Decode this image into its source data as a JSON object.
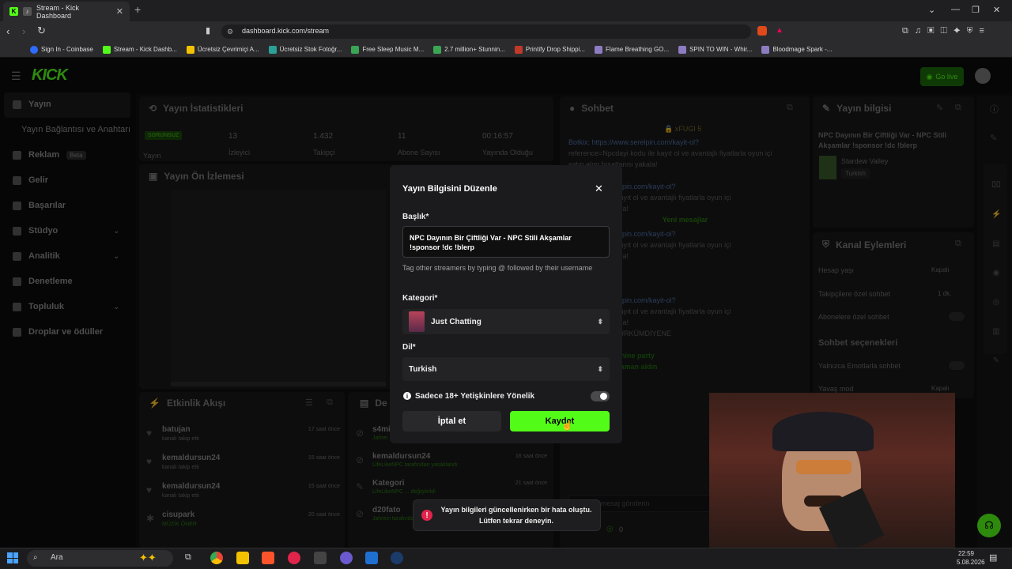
{
  "browser": {
    "tab_title": "Stream - Kick Dashboard",
    "url": "dashboard.kick.com/stream",
    "bookmarks": [
      "Sign In - Coinbase",
      "Stream - Kick Dashb...",
      "Ücretsiz Çevrimiçi A...",
      "Ücretsiz Stok Fotoğr...",
      "Free Sleep Music M...",
      "2.7 million+ Stunnin...",
      "Printify Drop Shippi...",
      "Flame Breathing GO...",
      "SPIN TO WIN - Whir...",
      "Bloodmage Spark -..."
    ]
  },
  "header": {
    "go_live": "Go live"
  },
  "sidebar": {
    "items": [
      {
        "label": "Yayın"
      },
      {
        "label": "Yayın Bağlantısı ve Anahtarı"
      },
      {
        "label": "Reklam",
        "badge": "Beta"
      },
      {
        "label": "Gelir"
      },
      {
        "label": "Başarılar"
      },
      {
        "label": "Stüdyo"
      },
      {
        "label": "Analitik"
      },
      {
        "label": "Denetleme"
      },
      {
        "label": "Topluluk"
      },
      {
        "label": "Droplar ve ödüller"
      }
    ]
  },
  "stats": {
    "title": "Yayın İstatistikleri",
    "status": "SORUNSUZ",
    "status_label": "Yayın",
    "items": [
      {
        "value": "13",
        "label": "İzleyici"
      },
      {
        "value": "1.432",
        "label": "Takipçi"
      },
      {
        "value": "11",
        "label": "Abone Sayısı"
      },
      {
        "value": "00:16:57",
        "label": "Yayında Olduğu"
      }
    ]
  },
  "preview": {
    "title": "Yayın Ön İzlemesi"
  },
  "activity": {
    "title": "Etkinlik Akışı",
    "events": [
      {
        "user": "batujan",
        "desc": "kanalı takip etti",
        "time": "17 saat önce"
      },
      {
        "user": "kemaldursun24",
        "desc": "kanalı takip etti",
        "time": "15 saat önce"
      },
      {
        "user": "kemaldursun24",
        "desc": "kanalı takip etti",
        "time": "15 saat önce"
      },
      {
        "user": "cisupark",
        "desc": "MÜZİK ÖNER",
        "time": "20 saat önce"
      }
    ]
  },
  "activity2": {
    "title": "De",
    "events": [
      {
        "user": "s4mi",
        "desc": "Jahrei",
        "time": ""
      },
      {
        "user": "kemaldursun24",
        "desc": "LifeLikeNPC tarafından yasaklandı",
        "time": "16 saat önce"
      },
      {
        "user": "Kategori",
        "desc": "LifeLikeNPC ... değiştirildi",
        "time": "21 saat önce"
      },
      {
        "user": "d20fato",
        "desc": "Jahrein tarafından",
        "time": ""
      }
    ]
  },
  "chat": {
    "title": "Sohbet",
    "pinned_user": "xFUGI",
    "new_messages": "Yeni mesajlar",
    "send_placeholder": "mesaj gönderin",
    "count": "0",
    "lines": [
      "Botkix: https://www.serelpin.com/kayit-ol?",
      "reference=Npcdayi kodu ile kayıt ol ve avantajlı fiyatlarla oyun içi",
      "satın alım fırsatlarını yakala!",
      "piteopaen:",
      "https://www.serelpin.com/kayit-ol?",
      "...dayi kodu ile kayıt ol ve avantajlı fiyatlarla oyun içi",
      "...ırsatlarını yakala!",
      "https://www.serelpin.com/kayit-ol?",
      "...dayi kodu ile kayıt ol ve avantajlı fiyatlarla oyun içi",
      "...ırsatlarını yakala!",
      "piteopaen: hi hi",
      "piteopaen:",
      "piteopaen:",
      "https://www.serelpin.com/kayit-ol?",
      "...dayi kodu ile kayıt ol ve avantajlı fiyatlarla oyun içi",
      "...ırsatlarını yakala!",
      "...ONEMUTLUTÜRKÜMDİYENE",
      "...ERDESİN",
      "piteopaen: machine party",
      "piteopaen: ne zaman aldın",
      "Takipçilere Özel"
    ]
  },
  "stream_info": {
    "title": "Yayın bilgisi",
    "stream_title": "NPC Dayının Bir Çiftliği Var - NPC Stili Akşamlar !sponsor !dc !blerp",
    "game": "Stardew Valley",
    "language": "Turkish"
  },
  "channel_actions": {
    "title": "Kanal Eylemleri",
    "rows": [
      {
        "label": "Hesap yaşı",
        "value": "Kapalı"
      },
      {
        "label": "Takipçilere özel sohbet",
        "value": "1 dk."
      },
      {
        "label": "Abonelere özel sohbet",
        "value": ""
      }
    ],
    "chat_options_title": "Sohbet seçenekleri",
    "options": [
      {
        "label": "Yalnızca Emotlarla sohbet",
        "value": ""
      },
      {
        "label": "Yavaş mod",
        "value": "Kapalı"
      }
    ]
  },
  "modal": {
    "heading": "Yayın Bilgisini Düzenle",
    "title_label": "Başlık*",
    "title_value": "NPC Dayının Bir Çiftliği Var - NPC Stili Akşamlar !sponsor !dc !blerp",
    "tag_hint": "Tag other streamers by typing @ followed by their username",
    "category_label": "Kategori*",
    "category_value": "Just Chatting",
    "language_label": "Dil*",
    "language_value": "Turkish",
    "mature_label": "Sadece 18+ Yetişkinlere Yönelik",
    "cancel": "İptal et",
    "save": "Kaydet"
  },
  "toast": {
    "message": "Yayın bilgileri güncellenirken bir hata oluştu. Lütfen tekrar deneyin."
  },
  "taskbar": {
    "search": "Ara",
    "time": "22:59",
    "date": "5.08.2026"
  },
  "colors": {
    "accent": "#53fc18",
    "error": "#e0244b"
  }
}
